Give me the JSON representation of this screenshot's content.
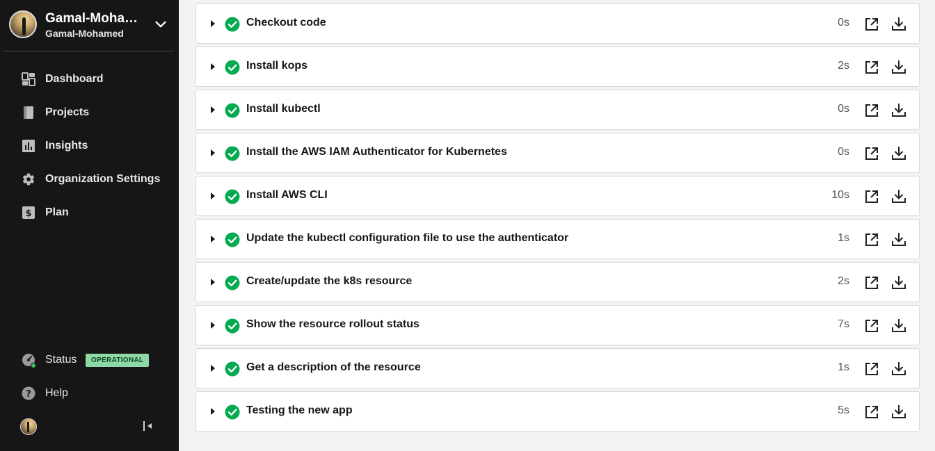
{
  "org": {
    "name": "Gamal-Moha…",
    "subname": "Gamal-Mohamed"
  },
  "nav": [
    {
      "label": "Dashboard",
      "icon": "dashboard-icon"
    },
    {
      "label": "Projects",
      "icon": "projects-icon"
    },
    {
      "label": "Insights",
      "icon": "insights-icon"
    },
    {
      "label": "Organization Settings",
      "icon": "gear-icon"
    },
    {
      "label": "Plan",
      "icon": "dollar-icon"
    }
  ],
  "status": {
    "label": "Status",
    "badge": "OPERATIONAL",
    "badge_color": "#8fd9a8"
  },
  "help": {
    "label": "Help"
  },
  "steps": [
    {
      "name": "Checkout code",
      "duration": "0s"
    },
    {
      "name": "Install kops",
      "duration": "2s"
    },
    {
      "name": "Install kubectl",
      "duration": "0s"
    },
    {
      "name": "Install the AWS IAM Authenticator for Kubernetes",
      "duration": "0s"
    },
    {
      "name": "Install AWS CLI",
      "duration": "10s"
    },
    {
      "name": "Update the kubectl configuration file to use the authenticator",
      "duration": "1s"
    },
    {
      "name": "Create/update the k8s resource",
      "duration": "2s"
    },
    {
      "name": "Show the resource rollout status",
      "duration": "7s"
    },
    {
      "name": "Get a description of the resource",
      "duration": "1s"
    },
    {
      "name": "Testing the new app",
      "duration": "5s"
    }
  ],
  "colors": {
    "sidebar_bg": "#161616",
    "success": "#04aa51",
    "main_bg": "#f3f3f3"
  }
}
